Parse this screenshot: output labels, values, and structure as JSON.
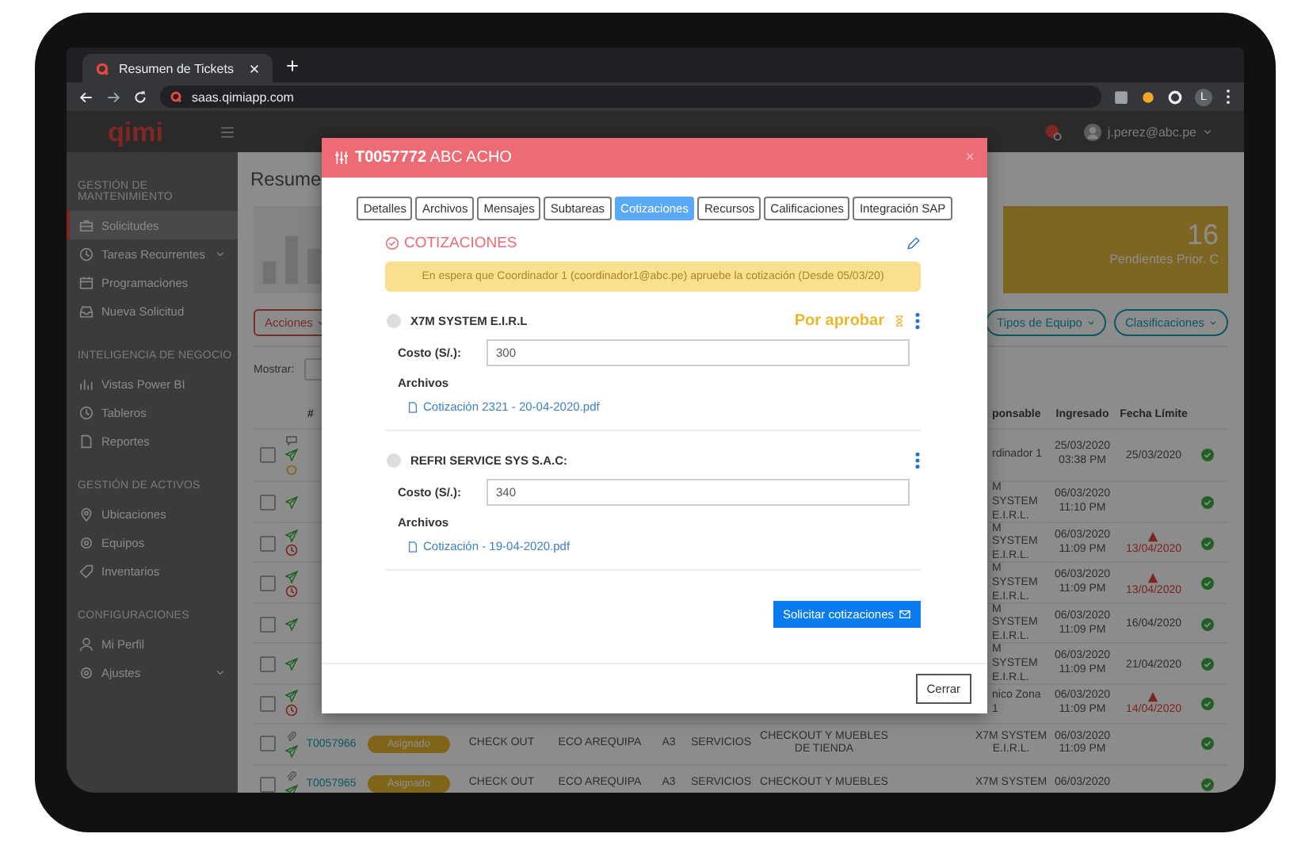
{
  "browser": {
    "tab_title": "Resumen de Tickets",
    "url": "saas.qimiapp.com",
    "profile_initial": "L"
  },
  "header": {
    "logo": "qimi",
    "user": "j.perez@abc.pe"
  },
  "sidebar": {
    "sections": [
      {
        "title": "GESTIÓN DE MANTENIMIENTO",
        "items": [
          {
            "label": "Solicitudes",
            "selected": true,
            "expandable": false
          },
          {
            "label": "Tareas Recurrentes",
            "selected": false,
            "expandable": true
          },
          {
            "label": "Programaciones",
            "selected": false,
            "expandable": false
          },
          {
            "label": "Nueva Solicitud",
            "selected": false,
            "expandable": false
          }
        ]
      },
      {
        "title": "INTELIGENCIA DE NEGOCIO",
        "items": [
          {
            "label": "Vistas Power BI",
            "selected": false,
            "expandable": false
          },
          {
            "label": "Tableros",
            "selected": false,
            "expandable": false
          },
          {
            "label": "Reportes",
            "selected": false,
            "expandable": false
          }
        ]
      },
      {
        "title": "GESTIÓN DE ACTIVOS",
        "items": [
          {
            "label": "Ubicaciones",
            "selected": false,
            "expandable": false
          },
          {
            "label": "Equipos",
            "selected": false,
            "expandable": false
          },
          {
            "label": "Inventarios",
            "selected": false,
            "expandable": false
          }
        ]
      },
      {
        "title": "CONFIGURACIONES",
        "items": [
          {
            "label": "Mi Perfil",
            "selected": false,
            "expandable": false
          },
          {
            "label": "Ajustes",
            "selected": false,
            "expandable": true
          }
        ]
      }
    ]
  },
  "main": {
    "title": "Resume",
    "summary_card": {
      "value": "16",
      "label": "Pendientes Prior. C"
    },
    "filters": [
      {
        "label": "Acciones",
        "kind": "menu"
      },
      {
        "label": "Tipos de Equipo",
        "kind": "filter"
      },
      {
        "label": "Clasificaciones",
        "kind": "filter"
      }
    ],
    "show_label": "Mostrar:",
    "table": {
      "columns": {
        "id": "#",
        "responsible": "ponsable",
        "entered": "Ingresado",
        "due": "Fecha Límite"
      },
      "rows": [
        {
          "checked": false,
          "indicators": [
            {
              "kind": "comment"
            },
            {
              "kind": "sent"
            },
            {
              "kind": "pending"
            }
          ],
          "responsible": "rdinador 1",
          "entered": "25/03/2020 03:38 PM",
          "due": "25/03/2020",
          "overdue": false
        },
        {
          "checked": false,
          "indicators": [
            {
              "kind": "sent"
            }
          ],
          "responsible": "M SYSTEM E.I.R.L.",
          "entered": "06/03/2020 11:10 PM",
          "overdue": false
        },
        {
          "checked": false,
          "indicators": [
            {
              "kind": "sent"
            },
            {
              "kind": "late"
            }
          ],
          "responsible": "M SYSTEM E.I.R.L.",
          "entered": "06/03/2020 11:09 PM",
          "due": "13/04/2020",
          "overdue": true
        },
        {
          "checked": false,
          "indicators": [
            {
              "kind": "sent"
            },
            {
              "kind": "late"
            }
          ],
          "responsible": "M SYSTEM E.I.R.L.",
          "entered": "06/03/2020 11:09 PM",
          "due": "13/04/2020",
          "overdue": true
        },
        {
          "checked": false,
          "indicators": [
            {
              "kind": "sent"
            }
          ],
          "responsible": "M SYSTEM E.I.R.L.",
          "entered": "06/03/2020 11:09 PM",
          "due": "16/04/2020",
          "overdue": false
        },
        {
          "checked": false,
          "indicators": [
            {
              "kind": "sent"
            }
          ],
          "responsible": "M SYSTEM E.I.R.L.",
          "entered": "06/03/2020 11:09 PM",
          "due": "21/04/2020",
          "overdue": false
        },
        {
          "checked": false,
          "indicators": [
            {
              "kind": "sent"
            },
            {
              "kind": "late"
            }
          ],
          "responsible": "nico Zona 1",
          "entered": "06/03/2020 11:09 PM",
          "due": "14/04/2020",
          "overdue": true
        },
        {
          "checked": false,
          "indicators": [
            {
              "kind": "attachment"
            },
            {
              "kind": "sent"
            }
          ],
          "id": "T0057966",
          "status": "Asignado",
          "type": "CHECK OUT",
          "site": "ECO AREQUIPA",
          "area": "A3",
          "category": "SERVICIOS",
          "description": "CHECKOUT Y MUEBLES DE TIENDA",
          "responsible": "X7M SYSTEM E.I.R.L.",
          "entered": "06/03/2020 11:09 PM",
          "overdue": false
        },
        {
          "checked": false,
          "indicators": [
            {
              "kind": "attachment"
            },
            {
              "kind": "sent"
            }
          ],
          "id": "T0057965",
          "status": "Asignado",
          "type": "CHECK OUT",
          "site": "ECO AREQUIPA",
          "area": "A3",
          "category": "SERVICIOS",
          "description": "CHECKOUT Y MUEBLES",
          "responsible": "X7M SYSTEM",
          "entered": "06/03/2020",
          "overdue": false
        }
      ]
    }
  },
  "modal": {
    "ticket_id": "T0057772",
    "ticket_name": "ABC ACHO",
    "close": "×",
    "tabs": [
      {
        "label": "Detalles",
        "selected": false
      },
      {
        "label": "Archivos",
        "selected": false
      },
      {
        "label": "Mensajes",
        "selected": false
      },
      {
        "label": "Subtareas",
        "selected": false
      },
      {
        "label": "Cotizaciones",
        "selected": true
      },
      {
        "label": "Recursos",
        "selected": false
      },
      {
        "label": "Calificaciones",
        "selected": false
      },
      {
        "label": "Integración SAP",
        "selected": false
      }
    ],
    "section_title": "COTIZACIONES",
    "notice": "En espera que Coordinador 1 (coordinador1@abc.pe) apruebe la cotización (Desde 05/03/20)",
    "quotes": [
      {
        "vendor": "X7M SYSTEM E.I.R.L",
        "selected": false,
        "status": "Por aprobar",
        "cost_label": "Costo (S/.):",
        "cost": "300",
        "files_label": "Archivos",
        "files": [
          "Cotización 2321 - 20-04-2020.pdf"
        ]
      },
      {
        "vendor": "REFRI SERVICE SYS S.A.C:",
        "selected": false,
        "cost_label": "Costo (S/.):",
        "cost": "340",
        "files_label": "Archivos",
        "files": [
          "Cotización - 19-04-2020.pdf"
        ]
      }
    ],
    "request_button": "Solicitar cotizaciones",
    "close_button": "Cerrar"
  }
}
